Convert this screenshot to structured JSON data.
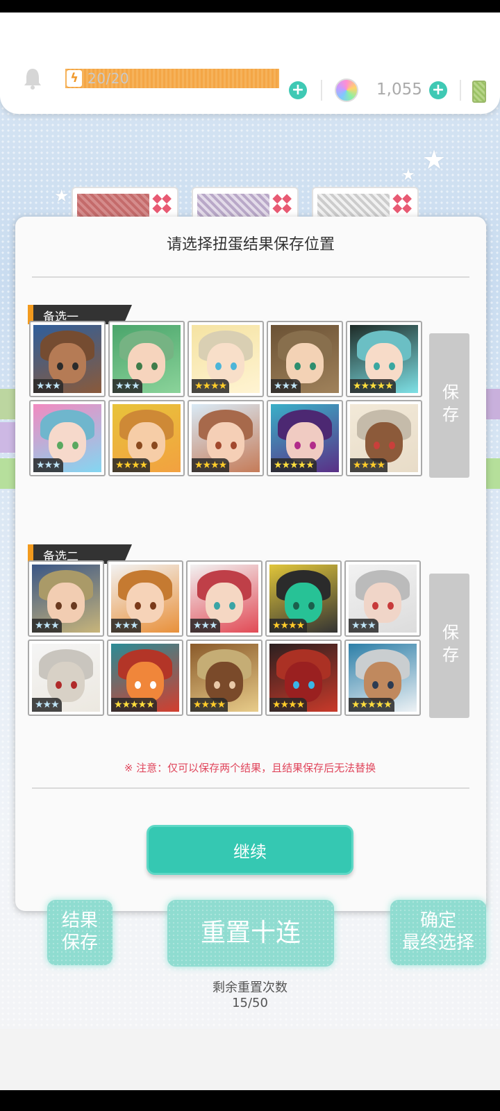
{
  "hud": {
    "stamina": "20/20",
    "currency": "1,055"
  },
  "modal": {
    "title": "请选择扭蛋结果保存位置",
    "slot1": {
      "label": "备选一",
      "save_label": "保存",
      "cards": [
        {
          "stars": "★★★",
          "rarity": 3,
          "palette": [
            "#2f5f9c",
            "#8a5a3a",
            "#b57b55",
            "#2b2b2b"
          ]
        },
        {
          "stars": "★★★",
          "rarity": 3,
          "palette": [
            "#4aa56b",
            "#8bd39a",
            "#f6d4bd",
            "#3f7c4a"
          ]
        },
        {
          "stars": "★★★★",
          "rarity": 4,
          "palette": [
            "#f5e3a2",
            "#fff4d3",
            "#f8dfc9",
            "#4cb5d8"
          ]
        },
        {
          "stars": "★★★",
          "rarity": 3,
          "palette": [
            "#6b5235",
            "#a0825b",
            "#f3d2b5",
            "#2e8e6e"
          ]
        },
        {
          "stars": "★★★★★",
          "rarity": 5,
          "palette": [
            "#1e2b27",
            "#7ee1e6",
            "#f7dbc8",
            "#3aa7a0"
          ]
        },
        {
          "stars": "★★★",
          "rarity": 3,
          "palette": [
            "#f28ac0",
            "#83d6f1",
            "#f6d9cb",
            "#5aa860"
          ]
        },
        {
          "stars": "★★★★",
          "rarity": 4,
          "palette": [
            "#e8c33a",
            "#f2a140",
            "#f6cda7",
            "#8a4a1f"
          ]
        },
        {
          "stars": "★★★★",
          "rarity": 4,
          "palette": [
            "#d9eaf6",
            "#c57b58",
            "#f5cfb6",
            "#a2492e"
          ]
        },
        {
          "stars": "★★★★★",
          "rarity": 5,
          "palette": [
            "#3ab0c8",
            "#5a2f86",
            "#f0cbc2",
            "#b12c8a"
          ]
        },
        {
          "stars": "★★★★",
          "rarity": 4,
          "palette": [
            "#f2e9d8",
            "#e8dcc8",
            "#8c5a3a",
            "#c9403b"
          ]
        }
      ]
    },
    "slot2": {
      "label": "备选二",
      "save_label": "保存",
      "cards": [
        {
          "stars": "★★★",
          "rarity": 3,
          "palette": [
            "#3a5686",
            "#c8b57a",
            "#f2cdb2",
            "#6a3a20"
          ]
        },
        {
          "stars": "★★★",
          "rarity": 3,
          "palette": [
            "#f2f2f2",
            "#e8903a",
            "#f6d3b8",
            "#7a3a1a"
          ]
        },
        {
          "stars": "★★★",
          "rarity": 3,
          "palette": [
            "#f2f2f2",
            "#e14a55",
            "#f5d7c3",
            "#3aa4a5"
          ]
        },
        {
          "stars": "★★★★",
          "rarity": 4,
          "palette": [
            "#e0c53a",
            "#333333",
            "#27c296",
            "#1b5f4c"
          ]
        },
        {
          "stars": "★★★",
          "rarity": 3,
          "palette": [
            "#f2f2f2",
            "#dcdcdc",
            "#f0d5c8",
            "#c73a3a"
          ]
        },
        {
          "stars": "★★★",
          "rarity": 3,
          "palette": [
            "#f5f5f5",
            "#ece8e0",
            "#d8d1c6",
            "#b02a2a"
          ]
        },
        {
          "stars": "★★★★★",
          "rarity": 5,
          "palette": [
            "#2a8c96",
            "#d33e2e",
            "#f0863a",
            "#ffffff"
          ]
        },
        {
          "stars": "★★★★",
          "rarity": 4,
          "palette": [
            "#8a5a2a",
            "#e8cc8a",
            "#7a4a2a",
            "#e9c9a8"
          ]
        },
        {
          "stars": "★★★★",
          "rarity": 4,
          "palette": [
            "#2b2020",
            "#c93a2a",
            "#9a2020",
            "#3ab5e6"
          ]
        },
        {
          "stars": "★★★★★",
          "rarity": 5,
          "palette": [
            "#2d7fa8",
            "#eef2f5",
            "#c0895e",
            "#2c3b52"
          ]
        }
      ]
    },
    "note": "※ 注意：仅可以保存两个结果，且结果保存后无法替换",
    "continue_label": "继续"
  },
  "footer": {
    "save_result_line1": "结果",
    "save_result_line2": "保存",
    "reset_label": "重置十连",
    "confirm_line1": "确定",
    "confirm_line2": "最终选择",
    "remain_label": "剩余重置次数",
    "remain_count": "15/50"
  },
  "colors": {
    "accent": "#35c8b2",
    "warning": "#e0465c",
    "stamina": "#f4a646"
  },
  "icons": [
    "bell-icon",
    "lightning-icon",
    "plus-icon",
    "rainbow-orb-icon",
    "battery-icon",
    "star-icon"
  ]
}
